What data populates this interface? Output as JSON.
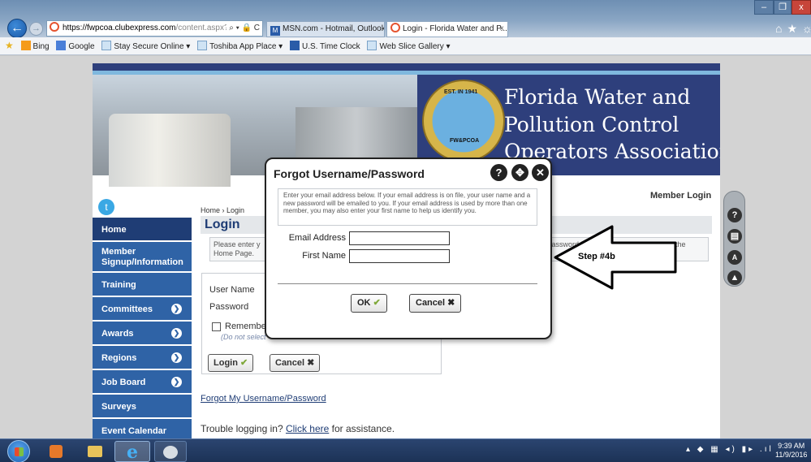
{
  "browser": {
    "address_host": "https://fwpcoa.clubexpress.com",
    "address_path": "/content.aspx?pag",
    "address_tools": "⌕ ▾ 🔒 C",
    "tabs": [
      {
        "label": "MSN.com - Hotmail, Outlook, ..."
      },
      {
        "label": "Login - Florida Water and P...",
        "close": "×"
      }
    ],
    "favorites": [
      {
        "label": "Bing"
      },
      {
        "label": "Google"
      },
      {
        "label": "Stay Secure Online ▾"
      },
      {
        "label": "Toshiba App Place ▾"
      },
      {
        "label": "U.S. Time Clock"
      },
      {
        "label": "Web Slice Gallery ▾"
      }
    ],
    "window_controls": {
      "min": "–",
      "max": "❐",
      "close": "x"
    },
    "right_icons": "⌂★☼"
  },
  "banner": {
    "est": "EST. IN 1941",
    "abbr": "FW&PCOA",
    "org_line1": "Florida Water and",
    "org_line2": "Pollution Control",
    "org_line3": "Operators Association"
  },
  "sidebar": {
    "items": [
      {
        "label": "Home",
        "arrow": false
      },
      {
        "label": "Member\nSignup/Information",
        "arrow": false
      },
      {
        "label": "Training",
        "arrow": false
      },
      {
        "label": "Committees",
        "arrow": true
      },
      {
        "label": "Awards",
        "arrow": true
      },
      {
        "label": "Regions",
        "arrow": true
      },
      {
        "label": "Job Board",
        "arrow": true
      },
      {
        "label": "Surveys",
        "arrow": false
      },
      {
        "label": "Event Calendar",
        "arrow": false
      }
    ]
  },
  "page": {
    "breadcrumb": "Home  ›  Login",
    "title": "Login",
    "member_login": "Member Login",
    "instructions_left": "Please enter y\nHome Page.",
    "instructions_right": "ur password is. Click \"Cancel\" to return to the",
    "username_label": "User Name",
    "password_label": "Password",
    "remember_label": "Remembe",
    "remember_note": "(Do not select",
    "login_button": "Login",
    "cancel_button": "Cancel",
    "forgot_link": "Forgot My Username/Password",
    "trouble_prefix": "Trouble logging in? ",
    "trouble_link": "Click here",
    "trouble_suffix": " for assistance."
  },
  "modal": {
    "title": "Forgot Username/Password",
    "info": "Enter your email address below. If your email address is on file, your user name and a new password will be emailed to you. If your email address is used by more than one member, you may also enter your first name to help us identify you.",
    "email_label": "Email Address",
    "email_value": "",
    "first_name_label": "First Name",
    "first_name_value": "",
    "ok_label": "OK",
    "cancel_label": "Cancel"
  },
  "annotation": {
    "step_label": "Step #4b"
  },
  "taskbar": {
    "time": "9:39 AM",
    "date": "11/9/2016"
  },
  "colors": {
    "nav_blue": "#2f63a6",
    "nav_home": "#1f3d75",
    "banner_navy": "#2e3f7c"
  }
}
